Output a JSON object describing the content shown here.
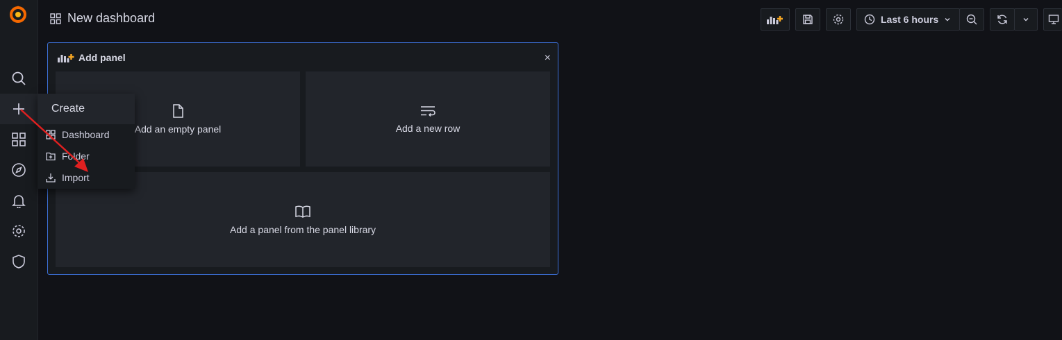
{
  "header": {
    "title": "New dashboard"
  },
  "toolbar": {
    "time_range": "Last 6 hours"
  },
  "add_panel": {
    "title": "Add panel",
    "close": "×",
    "options": [
      {
        "label": "Add an empty panel",
        "icon": "file-icon"
      },
      {
        "label": "Add a new row",
        "icon": "row-icon"
      },
      {
        "label": "Add a panel from the panel library",
        "icon": "book-icon"
      }
    ]
  },
  "create_menu": {
    "title": "Create",
    "items": [
      {
        "label": "Dashboard",
        "icon": "dashboard-icon"
      },
      {
        "label": "Folder",
        "icon": "folder-plus-icon"
      },
      {
        "label": "Import",
        "icon": "import-icon"
      }
    ]
  },
  "sidebar": {
    "items": [
      "search",
      "create",
      "dashboards",
      "explore",
      "alerting",
      "configuration",
      "server-admin"
    ]
  },
  "colors": {
    "background": "#111217",
    "sidebar": "#181b1f",
    "panel_border": "#3d71d9",
    "option_bg": "#22252b",
    "accent_orange": "#f5a623",
    "annotation_arrow": "#e02020"
  }
}
